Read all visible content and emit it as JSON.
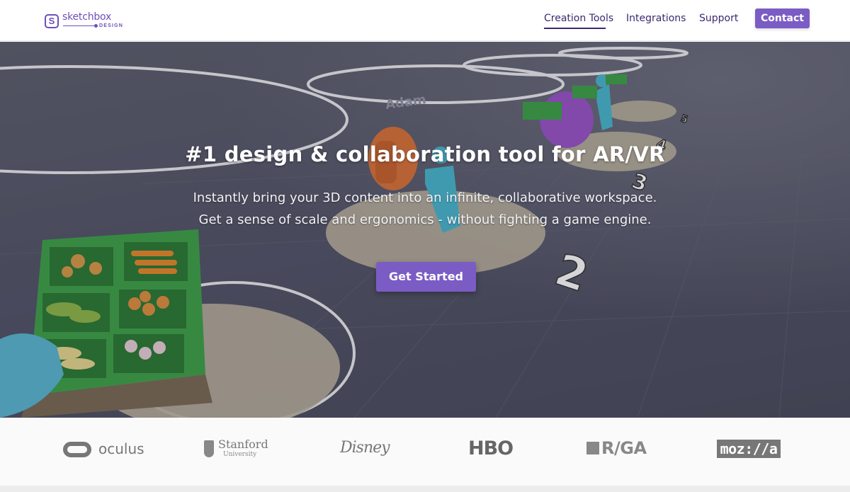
{
  "brand": {
    "badge": "S",
    "name": "sketchbox",
    "sub": "DESIGN",
    "accent_color": "#7b5cc4",
    "nav_color": "#3b2a6f"
  },
  "nav": {
    "items": [
      {
        "label": "Creation Tools",
        "active": true
      },
      {
        "label": "Integrations",
        "active": false
      },
      {
        "label": "Support",
        "active": false
      }
    ],
    "contact_label": "Contact"
  },
  "hero": {
    "title": "#1 design & collaboration tool for AR/VR",
    "subtitle_line1": "Instantly bring your 3D content into an infinite, collaborative workspace.",
    "subtitle_line2": "Get a sense of scale and ergonomics - without fighting a game engine.",
    "cta_label": "Get Started",
    "scene_text": {
      "name_tag": "Adam",
      "markers": [
        "2",
        "3",
        "4",
        "5"
      ]
    }
  },
  "clients": {
    "oculus": "oculus",
    "stanford_name": "Stanford",
    "stanford_sub": "University",
    "disney": "Disney",
    "hbo": "HBO",
    "rga": "R/GA",
    "mozilla": "moz://a"
  }
}
